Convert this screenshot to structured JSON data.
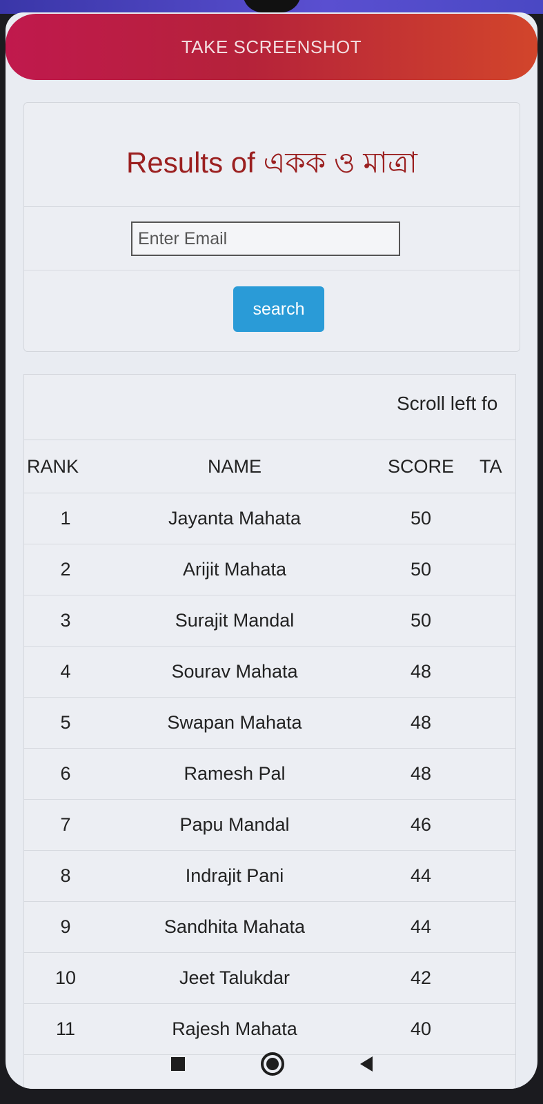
{
  "toolbar": {
    "screenshot_label": "TAKE SCREENSHOT"
  },
  "card": {
    "title": "Results of একক ও মাত্রা",
    "email_placeholder": "Enter Email",
    "search_label": "search"
  },
  "table": {
    "scroll_hint": "Scroll left fo",
    "headers": {
      "rank": "RANK",
      "name": "NAME",
      "score": "SCORE",
      "ta": "TA"
    },
    "rows": [
      {
        "rank": "1",
        "name": "Jayanta Mahata",
        "score": "50"
      },
      {
        "rank": "2",
        "name": "Arijit Mahata",
        "score": "50"
      },
      {
        "rank": "3",
        "name": "Surajit Mandal",
        "score": "50"
      },
      {
        "rank": "4",
        "name": "Sourav Mahata",
        "score": "48"
      },
      {
        "rank": "5",
        "name": "Swapan Mahata",
        "score": "48"
      },
      {
        "rank": "6",
        "name": "Ramesh Pal",
        "score": "48"
      },
      {
        "rank": "7",
        "name": "Papu Mandal",
        "score": "46"
      },
      {
        "rank": "8",
        "name": "Indrajit Pani",
        "score": "44"
      },
      {
        "rank": "9",
        "name": "Sandhita Mahata",
        "score": "44"
      },
      {
        "rank": "10",
        "name": "Jeet Talukdar",
        "score": "42"
      },
      {
        "rank": "11",
        "name": "Rajesh Mahata",
        "score": "40"
      }
    ]
  },
  "nav": {
    "icons": [
      "recents-square-icon",
      "home-circle-icon",
      "back-triangle-icon"
    ]
  },
  "colors": {
    "accent": "#2a9bd7",
    "title": "#9b2020",
    "banner": "#c0194d"
  }
}
